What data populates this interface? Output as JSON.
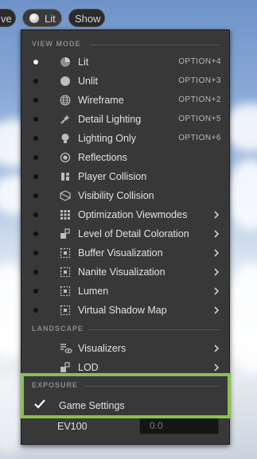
{
  "toolbar": {
    "left_label": "ve",
    "lit_label": "Lit",
    "show_label": "Show"
  },
  "menu": {
    "view_mode_header": "VIEW MODE",
    "items": [
      {
        "label": "Lit",
        "shortcut": "OPTION+4",
        "icon": "lit-sphere-icon",
        "active": true
      },
      {
        "label": "Unlit",
        "shortcut": "OPTION+3",
        "icon": "unlit-sphere-icon"
      },
      {
        "label": "Wireframe",
        "shortcut": "OPTION+2",
        "icon": "wireframe-globe-icon"
      },
      {
        "label": "Detail Lighting",
        "shortcut": "OPTION+5",
        "icon": "detail-lighting-icon"
      },
      {
        "label": "Lighting Only",
        "shortcut": "OPTION+6",
        "icon": "lightbulb-icon"
      },
      {
        "label": "Reflections",
        "shortcut": "",
        "icon": "reflections-icon"
      },
      {
        "label": "Player Collision",
        "shortcut": "",
        "icon": "player-collision-icon"
      },
      {
        "label": "Visibility Collision",
        "shortcut": "",
        "icon": "visibility-collision-icon"
      },
      {
        "label": "Optimization Viewmodes",
        "submenu": true,
        "icon": "grid-icon"
      },
      {
        "label": "Level of Detail Coloration",
        "submenu": true,
        "icon": "lod-coloration-icon"
      },
      {
        "label": "Buffer Visualization",
        "submenu": true,
        "icon": "buffer-icon"
      },
      {
        "label": "Nanite Visualization",
        "submenu": true,
        "icon": "nanite-icon"
      },
      {
        "label": "Lumen",
        "submenu": true,
        "icon": "lumen-icon"
      },
      {
        "label": "Virtual Shadow Map",
        "submenu": true,
        "icon": "shadow-map-icon"
      }
    ],
    "landscape_header": "LANDSCAPE",
    "landscape_items": [
      {
        "label": "Visualizers",
        "icon": "visualizers-icon"
      },
      {
        "label": "LOD",
        "icon": "lod-icon"
      }
    ],
    "exposure_header": "EXPOSURE",
    "game_settings_label": "Game Settings",
    "game_settings_checked": true,
    "ev100_label": "EV100",
    "ev100_value": "0.0"
  },
  "colors": {
    "highlight_border": "#8ac04d",
    "menu_bg": "#383838"
  }
}
